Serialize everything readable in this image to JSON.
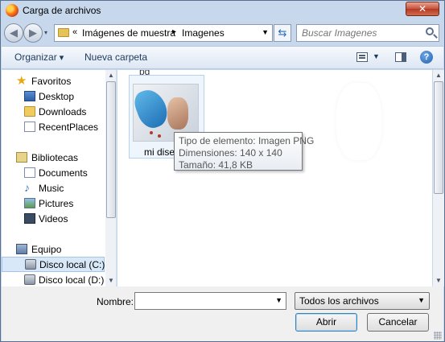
{
  "window": {
    "title": "Carga de archivos",
    "close_label": "✕"
  },
  "nav": {
    "address": {
      "chevron": "«",
      "segment1": "Imágenes de muestra",
      "separator": "▸",
      "segment2": "Imagenes"
    },
    "search": {
      "placeholder": "Buscar Imagenes"
    }
  },
  "toolbar": {
    "organize": "Organizar",
    "new_folder": "Nueva carpeta",
    "help": "?"
  },
  "sidebar": {
    "favorites": {
      "label": "Favoritos",
      "items": [
        "Desktop",
        "Downloads",
        "RecentPlaces"
      ]
    },
    "libraries": {
      "label": "Bibliotecas",
      "items": [
        "Documents",
        "Music",
        "Pictures",
        "Videos"
      ]
    },
    "computer": {
      "label": "Equipo",
      "items": [
        "Disco local (C:)",
        "Disco local (D:)"
      ]
    }
  },
  "files": {
    "top_cut": "pg",
    "item": {
      "name": "mi dise"
    },
    "tooltip": {
      "type": "Tipo de elemento: Imagen PNG",
      "dimensions": "Dimensiones: 140 x 140",
      "size": "Tamaño: 41,8 KB"
    }
  },
  "bottom": {
    "filename_label": "Nombre:",
    "filename_value": "",
    "filter": "Todos los archivos",
    "open_button": "Abrir",
    "cancel_button": "Cancelar"
  }
}
